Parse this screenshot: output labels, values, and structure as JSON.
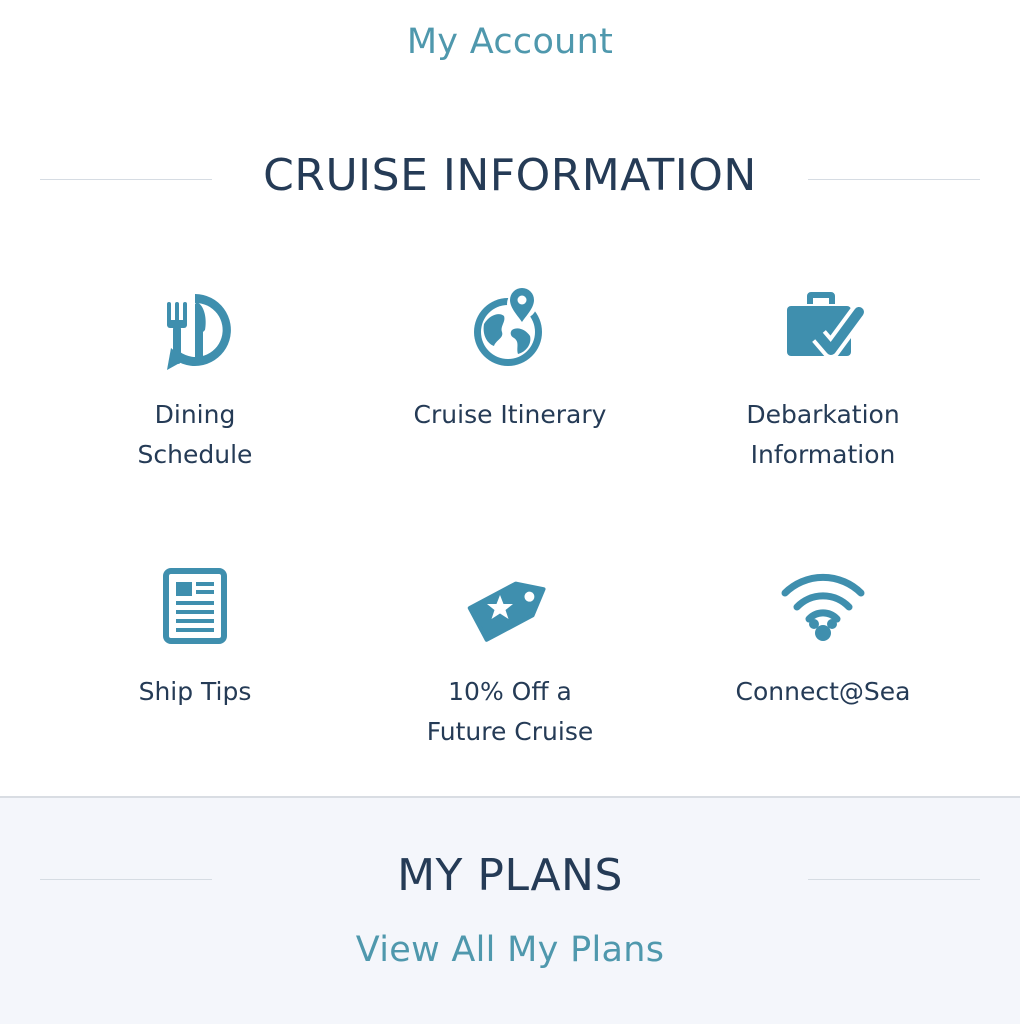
{
  "account_link": "My Account",
  "cruise_info": {
    "title": "CRUISE INFORMATION",
    "tiles": [
      {
        "icon": "dining-schedule-icon",
        "line1": "Dining",
        "line2": "Schedule"
      },
      {
        "icon": "globe-pin-icon",
        "line1": "Cruise Itinerary",
        "line2": ""
      },
      {
        "icon": "suitcase-check-icon",
        "line1": "Debarkation",
        "line2": "Information"
      },
      {
        "icon": "newspaper-icon",
        "line1": "Ship Tips",
        "line2": ""
      },
      {
        "icon": "star-tag-icon",
        "line1": "10% Off a",
        "line2": "Future Cruise"
      },
      {
        "icon": "wifi-mickey-icon",
        "line1": "Connect@Sea",
        "line2": ""
      }
    ]
  },
  "my_plans": {
    "title": "MY PLANS",
    "view_all_link": "View All My Plans"
  },
  "colors": {
    "accent": "#4f98ad",
    "heading": "#253b56",
    "icon": "#3f8fae",
    "bottom_bg": "#f4f6fb"
  }
}
